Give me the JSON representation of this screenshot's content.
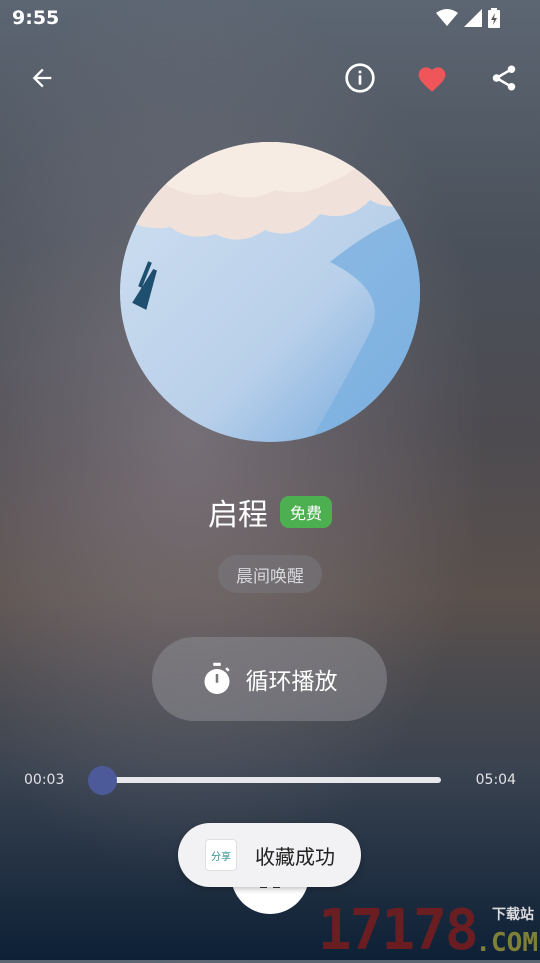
{
  "status_bar": {
    "time": "9:55"
  },
  "track": {
    "title": "启程",
    "badge": "免费",
    "tag": "晨间唤醒"
  },
  "controls": {
    "loop_label": "循环播放"
  },
  "progress": {
    "current": "00:03",
    "total": "05:04",
    "fraction": 0.01
  },
  "toast": {
    "icon_text": "分享",
    "message": "收藏成功"
  },
  "watermark": {
    "number": "17178",
    "site": "下载站",
    "suffix": ".COM"
  },
  "colors": {
    "favorite": "#f0555a",
    "badge": "#4caf50",
    "progress_accent": "#4d5a9a"
  }
}
